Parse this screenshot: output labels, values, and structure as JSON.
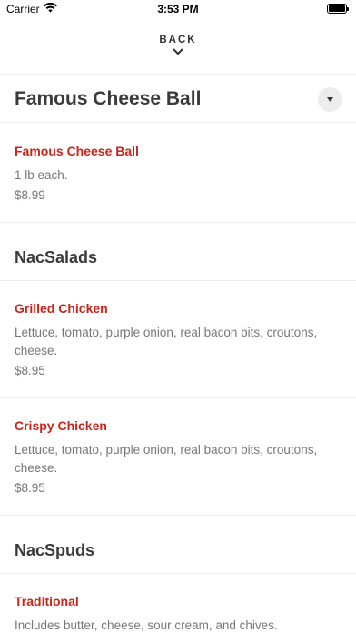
{
  "status_bar": {
    "carrier": "Carrier",
    "time": "3:53 PM"
  },
  "header": {
    "back_label": "BACK"
  },
  "category_bar": {
    "title": "Famous Cheese Ball"
  },
  "menu": {
    "cheese_ball_items": [
      {
        "name": "Famous Cheese Ball",
        "description": "1 lb each.",
        "price": "$8.99"
      }
    ],
    "sections": [
      {
        "title": "NacSalads",
        "items": [
          {
            "name": "Grilled Chicken",
            "description": "Lettuce, tomato, purple onion, real bacon bits, croutons, cheese.",
            "price": "$8.95"
          },
          {
            "name": "Crispy Chicken",
            "description": "Lettuce, tomato, purple onion, real bacon bits, croutons, cheese.",
            "price": "$8.95"
          }
        ]
      },
      {
        "title": "NacSpuds",
        "items": [
          {
            "name": "Traditional",
            "description": "Includes butter, cheese, sour cream, and chives."
          }
        ]
      }
    ]
  },
  "icons": {
    "wifi": "wifi-icon",
    "battery": "battery-icon",
    "back": "chevron-down-icon",
    "dropdown": "caret-down-icon"
  }
}
